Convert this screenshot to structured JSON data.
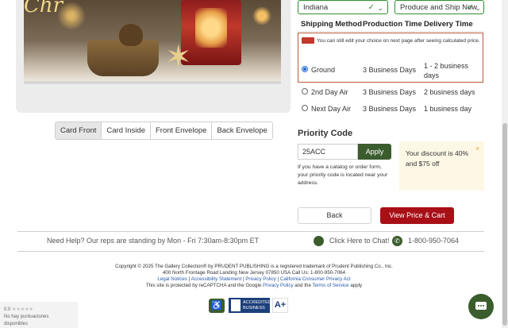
{
  "preview": {
    "script_text": "Chr",
    "view_tabs": [
      "Card Front",
      "Card Inside",
      "Front Envelope",
      "Back Envelope"
    ],
    "active_tab": "Card Front"
  },
  "selects": {
    "state": "Indiana",
    "ship_option": "Produce and Ship Now"
  },
  "shipping": {
    "headers": {
      "method": "Shipping Method",
      "production": "Production Time",
      "delivery": "Delivery Time"
    },
    "notice": "You can still edit your choice on next page after seeing calculated price.",
    "options": [
      {
        "method": "Ground",
        "production": "3 Business Days",
        "delivery": "1 - 2 business days",
        "selected": true
      },
      {
        "method": "2nd Day Air",
        "production": "3 Business Days",
        "delivery": "2 business days",
        "selected": false
      },
      {
        "method": "Next Day Air",
        "production": "3 Business Days",
        "delivery": "1 business day",
        "selected": false
      }
    ]
  },
  "priority_code": {
    "title": "Priority Code",
    "value": "25ACC",
    "apply_label": "Apply",
    "help": "If you have a catalog or order form, your priority code is located near your address.",
    "discount_text": "Your discount is 40% and $75 off",
    "close": "×"
  },
  "actions": {
    "back": "Back",
    "view_price": "View Price & Cart"
  },
  "help_bar": {
    "text": "Need Help? Our reps are standing by Mon - Fri 7:30am-8:30pm ET",
    "chat": "Click Here to Chat!",
    "phone": "1-800-950-7064"
  },
  "footer": {
    "line1": "Copyright © 2025 The Gallery Collection® by PRUDENT PUBLISHING is a registered trademark of Prudent Publishing Co., Inc.",
    "line2": "400 North Frontage Road Landing New Jersey 07850 USA Call Us: 1-800-950-7064",
    "links": [
      "Legal Notices",
      "Accessibility Statement",
      "Privacy Policy",
      "California Consumer Privacy Act"
    ],
    "line4_a": "This site is protected by reCAPTCHA and the Google ",
    "line4_privacy": "Privacy Policy",
    "line4_and": " and the ",
    "line4_terms": "Terms of Service",
    "line4_b": " apply",
    "bbb_label": "ACCREDITED BUSINESS",
    "bbb_grade": "A+"
  },
  "reviews": {
    "score": "0.0",
    "text": "No hay puntuaciones disponibles"
  },
  "colors": {
    "accent_green": "#3b5d2e",
    "cta_red": "#a80f16",
    "select_border": "#2f8f2f"
  }
}
